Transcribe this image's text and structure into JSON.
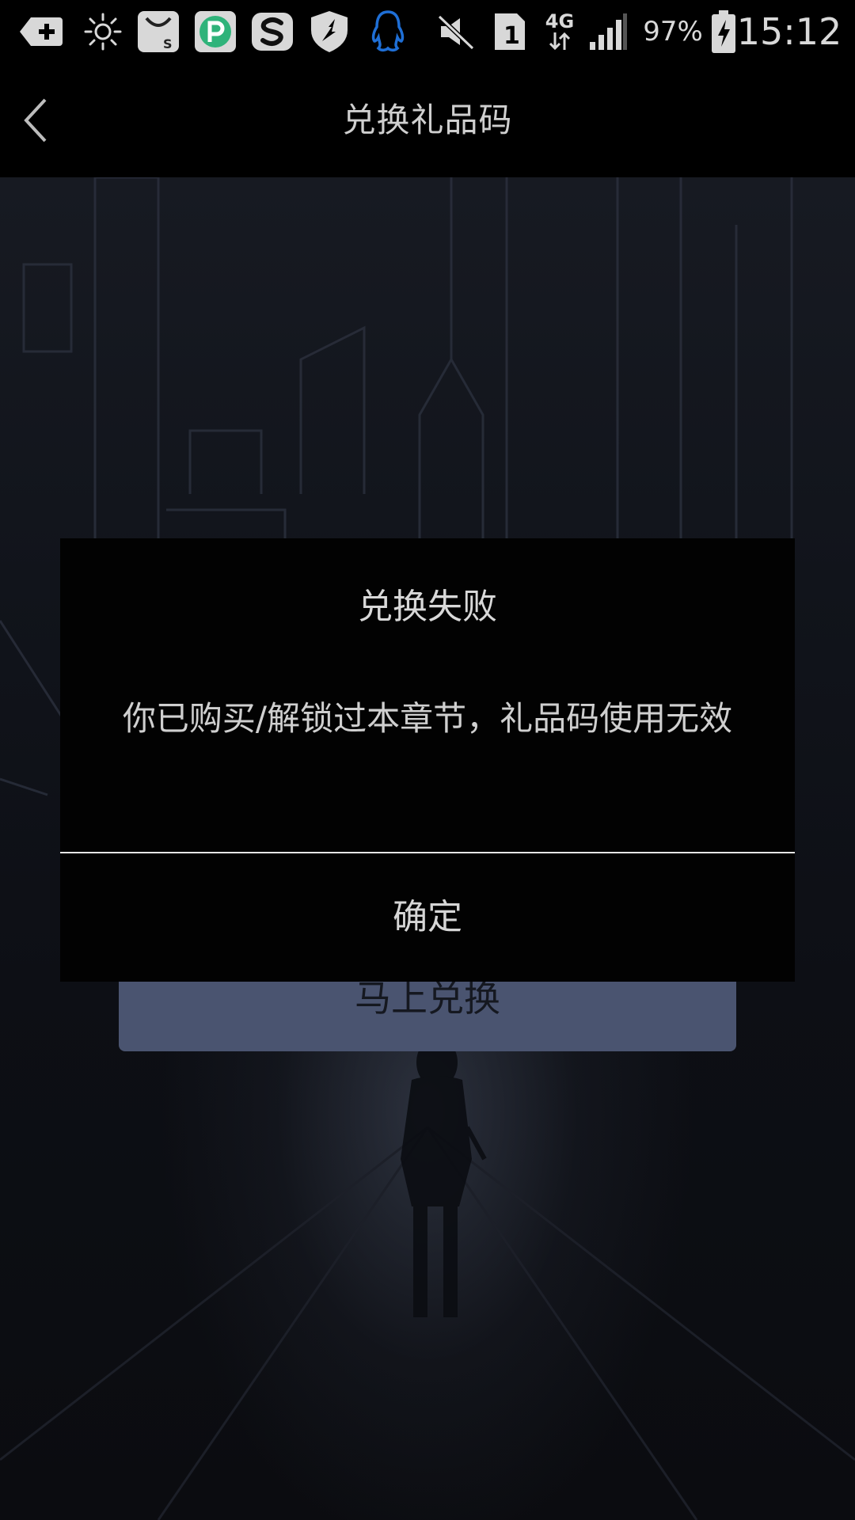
{
  "status_bar": {
    "icons": [
      "add-notification-icon",
      "brightness-icon",
      "shopping-bag-icon",
      "p-app-icon",
      "s-app-icon",
      "shield-icon",
      "qq-penguin-icon",
      "mute-icon",
      "sim-1-icon",
      "4g-data-icon",
      "signal-icon",
      "battery-charging-icon"
    ],
    "network": "4G",
    "sim_slot": "1",
    "battery_percent": "97%",
    "time": "15:12"
  },
  "header": {
    "title": "兑换礼品码",
    "back_icon": "chevron-left-icon"
  },
  "main": {
    "redeem_button_label": "马上兑换"
  },
  "dialog": {
    "title": "兑换失败",
    "message": "你已购买/解锁过本章节，礼品码使用无效",
    "confirm_label": "确定"
  },
  "colors": {
    "status_bar_bg": "#000000",
    "header_bg": "#000000",
    "dialog_bg": "#020202",
    "redeem_button_bg": "#4a5470",
    "text_light": "#d6d6d6",
    "p_app_green": "#2fb37a",
    "qq_blue": "#1f6fd6"
  }
}
